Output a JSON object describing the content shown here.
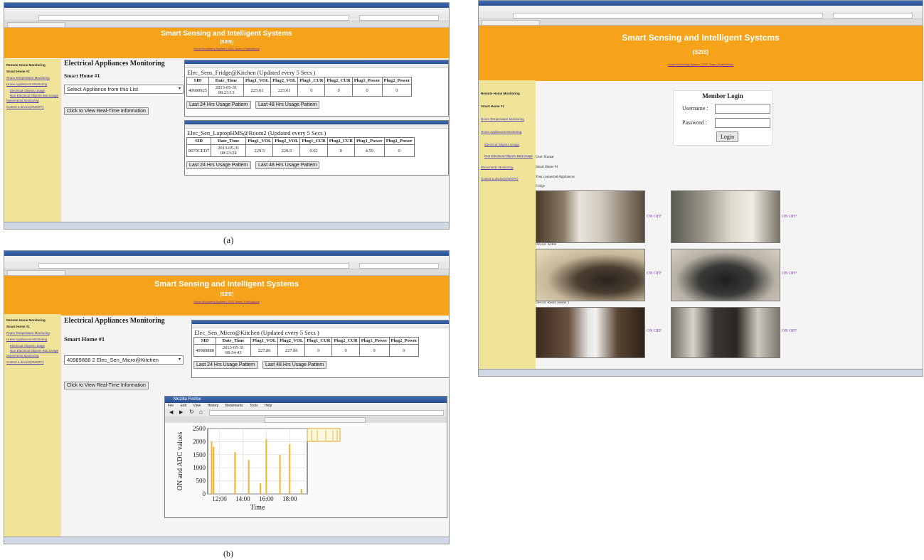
{
  "banner": {
    "title": "Smart Sensing and Intelligent Systems",
    "abbr": "(S2IS)",
    "links": "Home  Monitoring System  |  S2IS Team  |  Publications"
  },
  "sidebar": {
    "items": [
      "Remote Home Monitoring",
      "Smart Home #1",
      "Room Temperature Monitoring",
      "Home Appliances Monitoring",
      "Electrical Objects Usage",
      "Non-Electrical Objects Bed Usage",
      "Movements Monitoring",
      "Control a device(ON/OFF)"
    ]
  },
  "panel_a": {
    "heading": "Electrical Appliances Monitoring",
    "home": "Smart Home #1",
    "select_value": "Select Appliance from this List",
    "view_button": "Click to View Real-Time Information",
    "popup1": {
      "header": "Elec_Sens_Fridge@Kitchen (Updated every 5 Secs )",
      "columns": [
        "SID",
        "Date_Time",
        "Plug1_VOL",
        "Plug2_VOL",
        "Plug1_CUR",
        "Plug2_CUR",
        "Plug1_Power",
        "Plug2_Power"
      ],
      "row": [
        "40680925",
        "2013-05-31 08:23:13",
        "225.61",
        "225.61",
        "0",
        "0",
        "0",
        "0"
      ],
      "btn24": "Last 24 Hrs Usage Pattern",
      "btn48": "Last 48 Hrs Usage Pattern"
    },
    "popup2": {
      "header": "Elec_Sen_LaptopHMS@Room2 (Updated every 5 Secs )",
      "columns": [
        "SID",
        "Date_Time",
        "Plug1_VOL",
        "Plug2_VOL",
        "Plug1_CUR",
        "Plug2_CUR",
        "Plug1_Power",
        "Plug2_Power"
      ],
      "row": [
        "8079CED7",
        "2013-05-31 08:23:24",
        "229.5",
        "229.5",
        "0.02",
        "0",
        "4.59",
        "0"
      ],
      "btn24": "Last 24 Hrs Usage Pattern",
      "btn48": "Last 48 Hrs Usage Pattern"
    },
    "caption": "(a)"
  },
  "panel_b": {
    "heading": "Electrical Appliances Monitoring",
    "home": "Smart Home #1",
    "select_value": "40989888 2 Elec_Sen_Micro@Kitchen",
    "view_button": "Click to View Real-Time Information",
    "popup": {
      "header": "Elec_Sen_Micro@Kitchen (Updated every 5 Secs )",
      "columns": [
        "SID",
        "Date_Time",
        "Plug1_VOL",
        "Plug2_VOL",
        "Plug1_CUR",
        "Plug2_CUR",
        "Plug1_Power",
        "Plug2_Power"
      ],
      "row": [
        "40989888",
        "2013-05-31 08:34:43",
        "227.86",
        "227.86",
        "0",
        "0",
        "0",
        "0"
      ],
      "btn24": "Last 24 Hrs Usage Pattern",
      "btn48": "Last 48 Hrs Usage Pattern"
    },
    "firefox": {
      "title": "Mozilla Firefox",
      "menu": [
        "File",
        "Edit",
        "View",
        "History",
        "Bookmarks",
        "Tools",
        "Help"
      ]
    },
    "caption": "(b)"
  },
  "chart_data": {
    "type": "bar",
    "x": [
      "11:20",
      "11:30",
      "13:20",
      "14:30",
      "15:30",
      "16:00",
      "17:10",
      "18:00",
      "19:00"
    ],
    "values": [
      2000,
      1800,
      1600,
      1300,
      400,
      2100,
      1500,
      1900,
      200
    ],
    "xticks": [
      "12:00",
      "14:00",
      "16:00",
      "18:00"
    ],
    "yticks": [
      "0",
      "500",
      "1000",
      "1500",
      "2000",
      "2500"
    ],
    "xlabel": "Time",
    "ylabel": "ON and ADC values",
    "ylim": [
      0,
      2500
    ],
    "grid": true,
    "color": "#f0b429"
  },
  "panel_c": {
    "login_title": "Member Login",
    "username_label": "Username :",
    "password_label": "Password :",
    "login_button": "Login",
    "user_line": "User: Kumar",
    "home_line": "Smart Home #1",
    "appliances_line": "Your connected Appliances",
    "devices": [
      {
        "label": "Fridge",
        "on": "ON",
        "off": "OFF"
      },
      {
        "label": "",
        "on": "ON",
        "off": "OFF"
      },
      {
        "label": "Device: Kettle",
        "on": "ON",
        "off": "OFF"
      },
      {
        "label": "",
        "on": "ON",
        "off": "OFF"
      },
      {
        "label": "Device: Room Heater 2",
        "on": "ON",
        "off": "OFF"
      },
      {
        "label": "",
        "on": "ON",
        "off": "OFF"
      }
    ]
  },
  "colors": {
    "banner": "#f6a31b",
    "sidebar": "#efe49a",
    "link": "#6a2b9c"
  }
}
